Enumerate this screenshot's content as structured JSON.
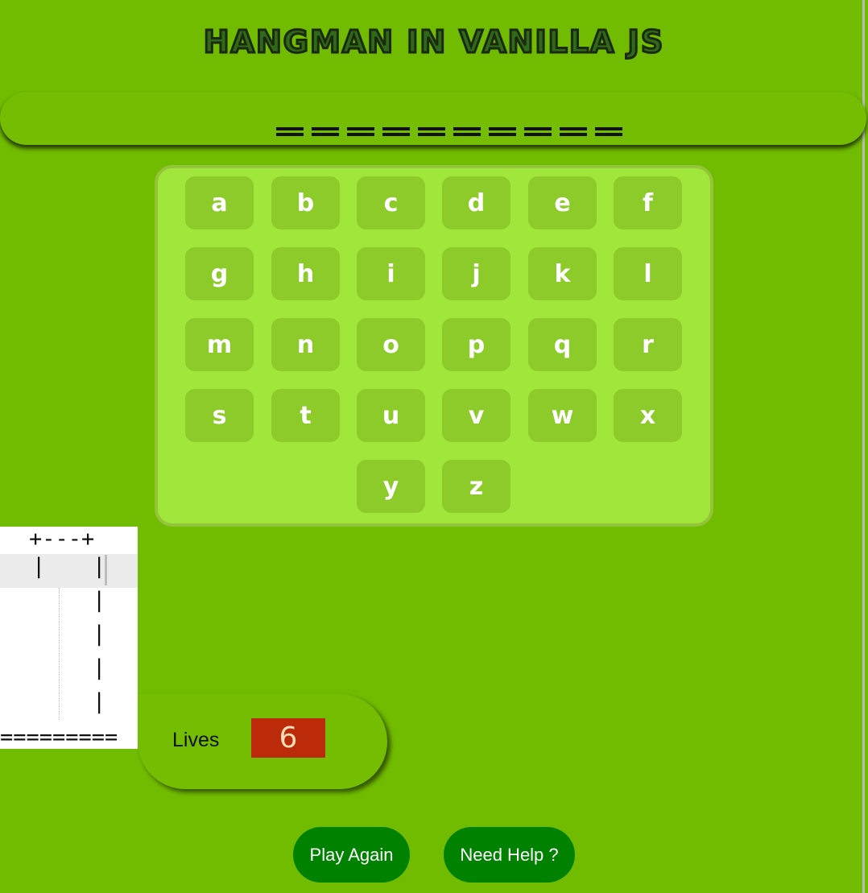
{
  "title": "HANGMAN IN VANILLA JS",
  "word": {
    "slot_count": 10
  },
  "keyboard": {
    "letters": [
      "a",
      "b",
      "c",
      "d",
      "e",
      "f",
      "g",
      "h",
      "i",
      "j",
      "k",
      "l",
      "m",
      "n",
      "o",
      "p",
      "q",
      "r",
      "s",
      "t",
      "u",
      "v",
      "w",
      "x",
      "y",
      "z"
    ]
  },
  "gallows": {
    "top": "+---+",
    "post": "|",
    "rope": "|",
    "base": "========="
  },
  "lives": {
    "label": "Lives",
    "count": "6"
  },
  "buttons": {
    "play_again": "Play Again",
    "need_help": "Need Help ?"
  },
  "colors": {
    "background": "#71bc00",
    "keyboard_panel": "#a1e63a",
    "key": "#8dcb2a",
    "lives_badge": "#bb2b09",
    "button": "#008200"
  }
}
